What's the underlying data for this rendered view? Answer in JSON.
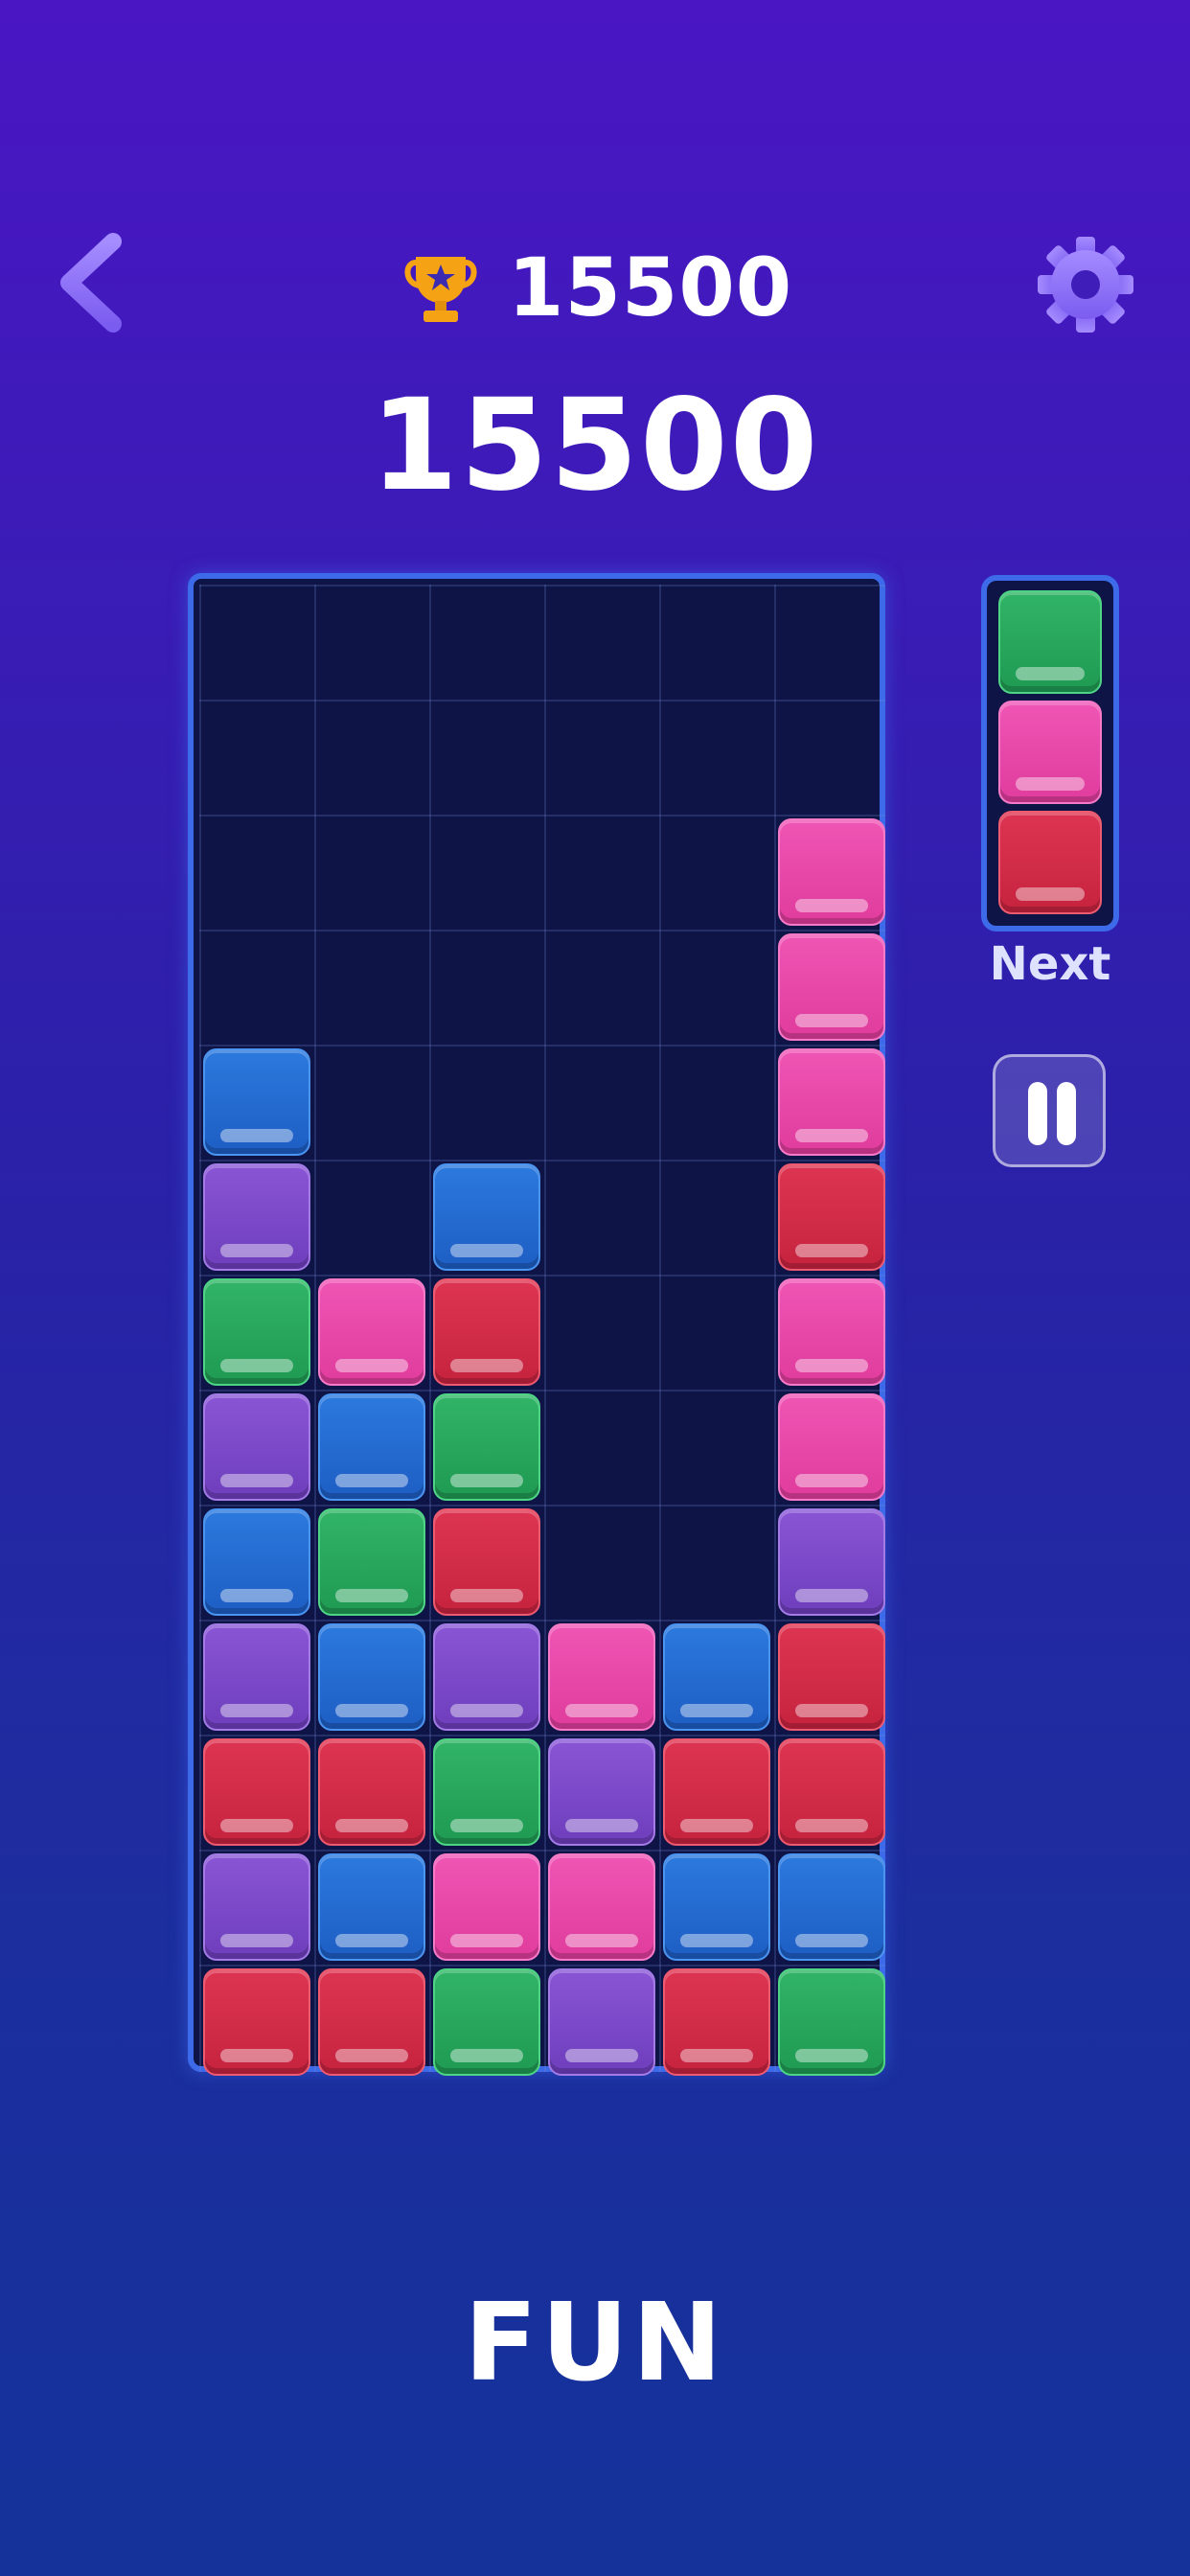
{
  "header": {
    "best_score": "15500",
    "score": "15500",
    "back_icon": "chevron-left-icon",
    "trophy_icon": "trophy-icon",
    "settings_icon": "gear-icon"
  },
  "board": {
    "columns": 6,
    "rows": 13,
    "blocks": [
      {
        "row": 2,
        "col": 5,
        "color": "pink"
      },
      {
        "row": 3,
        "col": 5,
        "color": "pink"
      },
      {
        "row": 4,
        "col": 0,
        "color": "blue"
      },
      {
        "row": 4,
        "col": 5,
        "color": "pink"
      },
      {
        "row": 5,
        "col": 0,
        "color": "purple"
      },
      {
        "row": 5,
        "col": 2,
        "color": "blue"
      },
      {
        "row": 5,
        "col": 5,
        "color": "red"
      },
      {
        "row": 6,
        "col": 0,
        "color": "green"
      },
      {
        "row": 6,
        "col": 1,
        "color": "pink"
      },
      {
        "row": 6,
        "col": 2,
        "color": "red"
      },
      {
        "row": 6,
        "col": 5,
        "color": "pink"
      },
      {
        "row": 7,
        "col": 0,
        "color": "purple"
      },
      {
        "row": 7,
        "col": 1,
        "color": "blue"
      },
      {
        "row": 7,
        "col": 2,
        "color": "green"
      },
      {
        "row": 7,
        "col": 5,
        "color": "pink"
      },
      {
        "row": 8,
        "col": 0,
        "color": "blue"
      },
      {
        "row": 8,
        "col": 1,
        "color": "green"
      },
      {
        "row": 8,
        "col": 2,
        "color": "red"
      },
      {
        "row": 8,
        "col": 5,
        "color": "purple"
      },
      {
        "row": 9,
        "col": 0,
        "color": "purple"
      },
      {
        "row": 9,
        "col": 1,
        "color": "blue"
      },
      {
        "row": 9,
        "col": 2,
        "color": "purple"
      },
      {
        "row": 9,
        "col": 3,
        "color": "pink"
      },
      {
        "row": 9,
        "col": 4,
        "color": "blue"
      },
      {
        "row": 9,
        "col": 5,
        "color": "red"
      },
      {
        "row": 10,
        "col": 0,
        "color": "red"
      },
      {
        "row": 10,
        "col": 1,
        "color": "red"
      },
      {
        "row": 10,
        "col": 2,
        "color": "green"
      },
      {
        "row": 10,
        "col": 3,
        "color": "purple"
      },
      {
        "row": 10,
        "col": 4,
        "color": "red"
      },
      {
        "row": 10,
        "col": 5,
        "color": "red"
      },
      {
        "row": 11,
        "col": 0,
        "color": "purple"
      },
      {
        "row": 11,
        "col": 1,
        "color": "blue"
      },
      {
        "row": 11,
        "col": 2,
        "color": "pink"
      },
      {
        "row": 11,
        "col": 3,
        "color": "pink"
      },
      {
        "row": 11,
        "col": 4,
        "color": "blue"
      },
      {
        "row": 11,
        "col": 5,
        "color": "blue"
      },
      {
        "row": 12,
        "col": 0,
        "color": "red"
      },
      {
        "row": 12,
        "col": 1,
        "color": "red"
      },
      {
        "row": 12,
        "col": 2,
        "color": "green"
      },
      {
        "row": 12,
        "col": 3,
        "color": "purple"
      },
      {
        "row": 12,
        "col": 4,
        "color": "red"
      },
      {
        "row": 12,
        "col": 5,
        "color": "green"
      }
    ]
  },
  "next": {
    "label": "Next",
    "pieces": [
      "green",
      "pink",
      "red"
    ]
  },
  "controls": {
    "pause_icon": "pause-icon"
  },
  "mode": {
    "label": "FUN"
  },
  "colors": {
    "pink": "#e64aa8",
    "red": "#d02c48",
    "blue": "#2569d2",
    "purple": "#7c49c9",
    "green": "#28a85c",
    "board_border": "#3d6ae8",
    "board_bg": "#0e1546",
    "trophy": "#f5a214"
  }
}
